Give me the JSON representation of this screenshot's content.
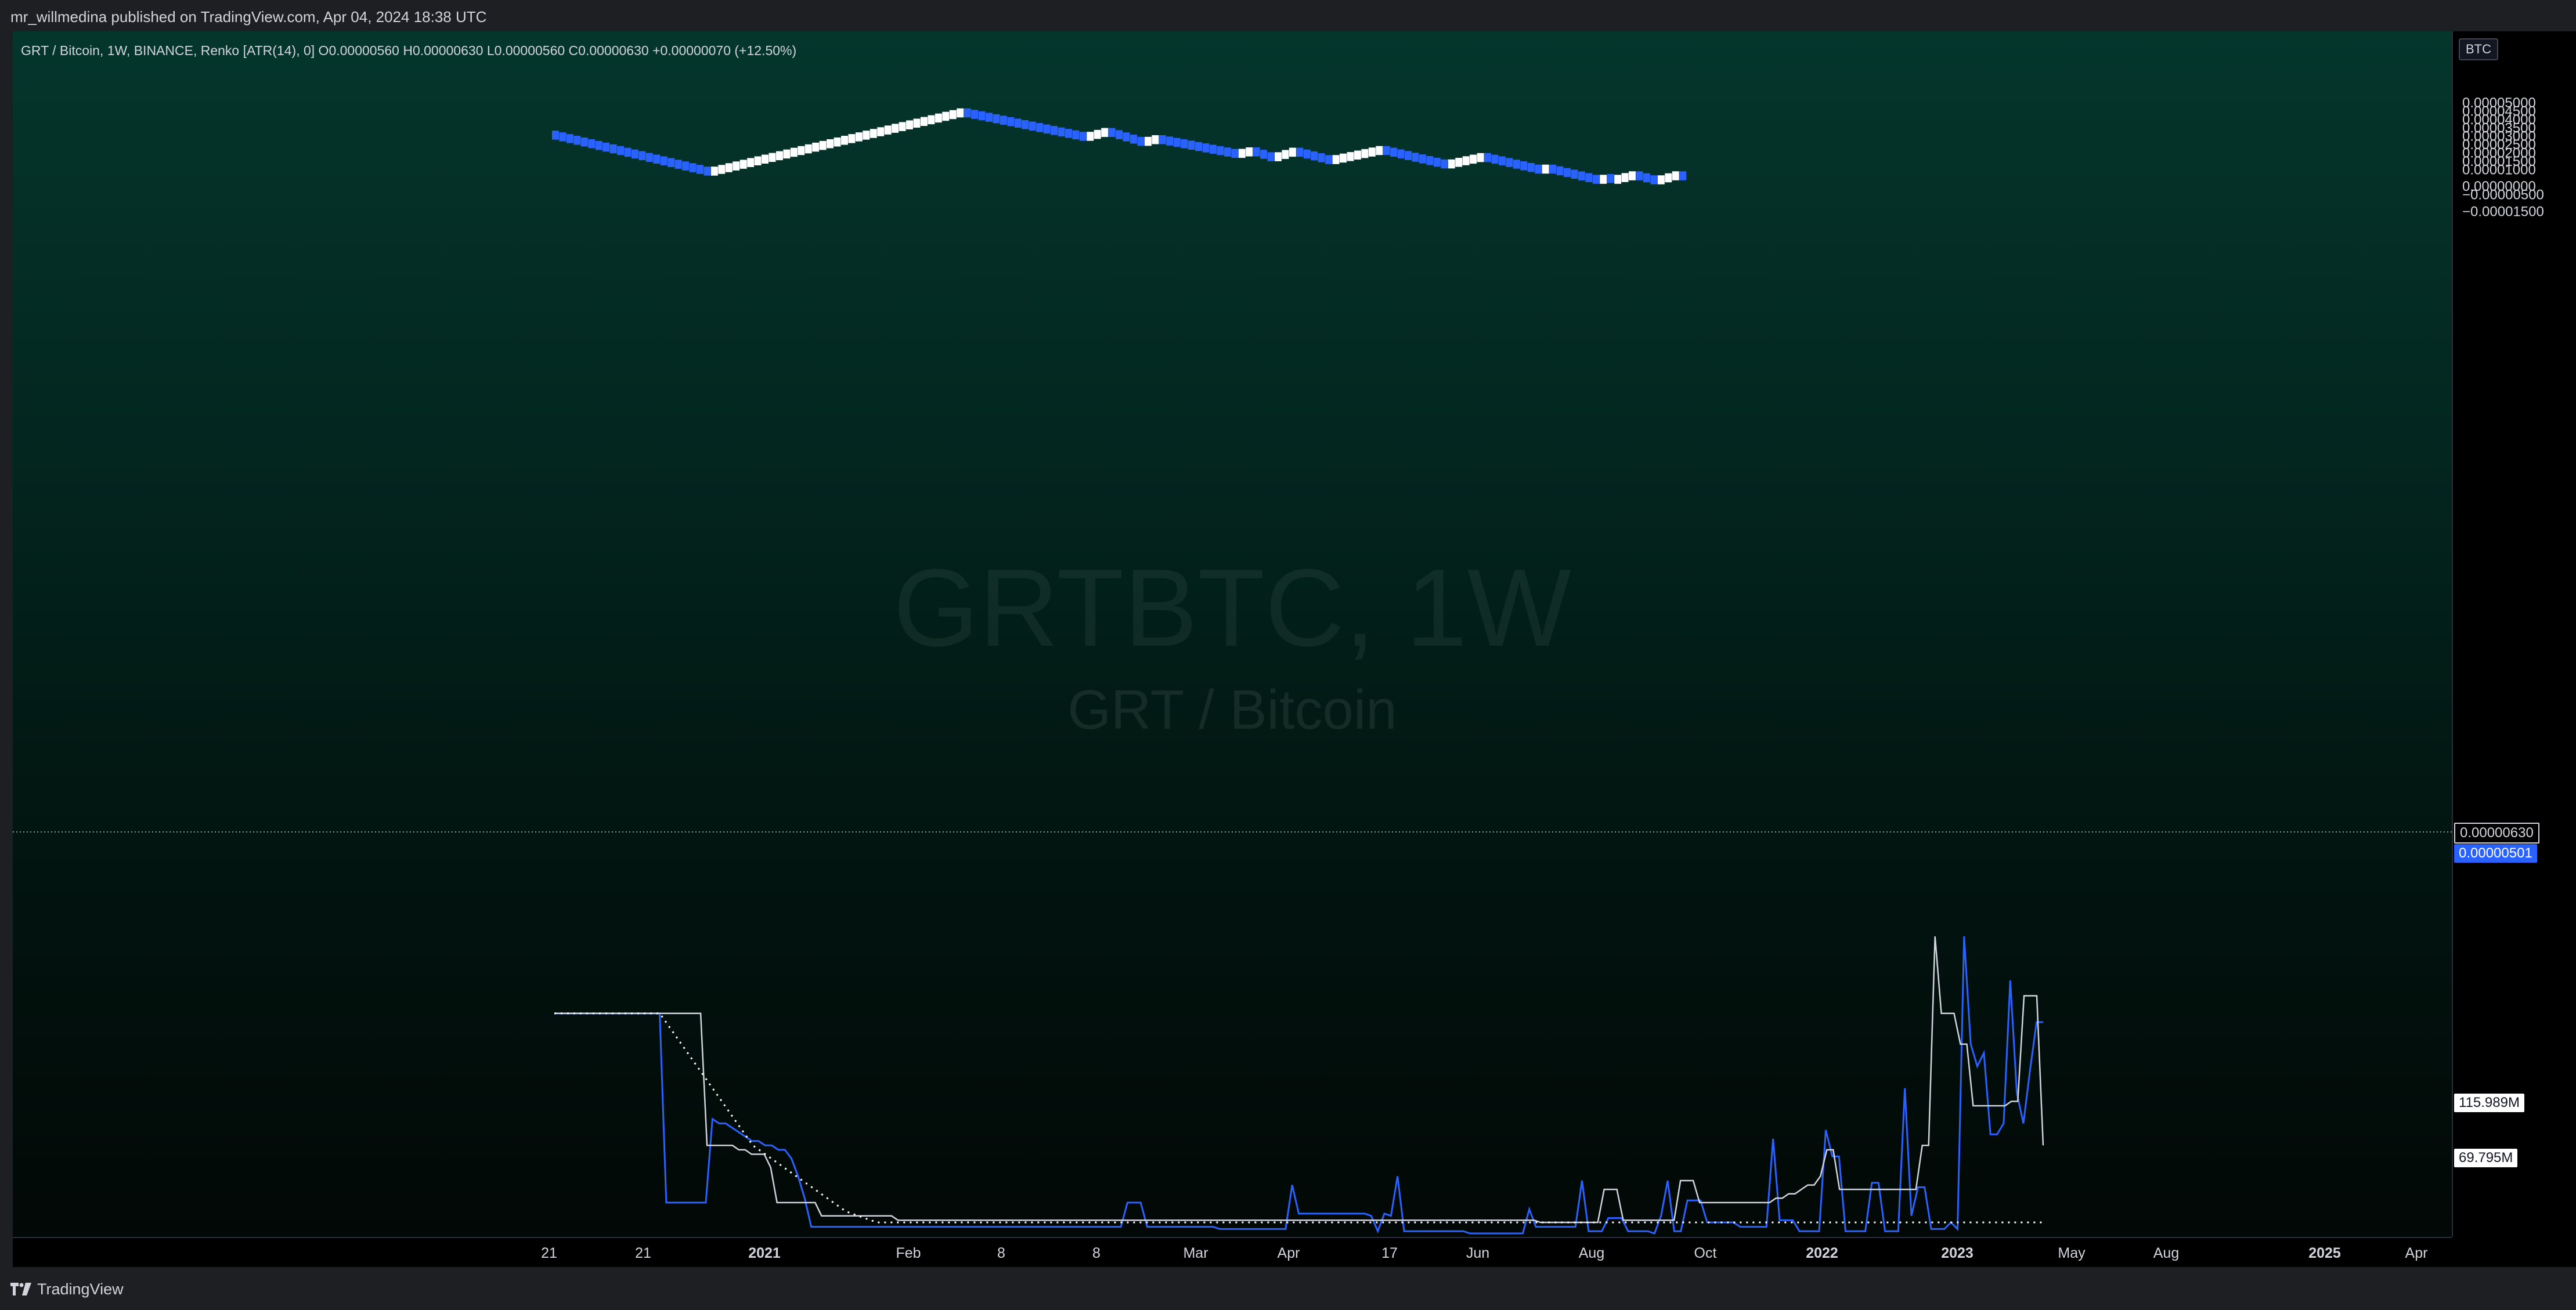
{
  "header": {
    "publisher": "mr_willmedina published on TradingView.com, Apr 04, 2024 18:38 UTC"
  },
  "footer": {
    "logo_text": "TradingView"
  },
  "legend": {
    "text": "GRT / Bitcoin, 1W, BINANCE, Renko [ATR(14), 0]  O0.00000560  H0.00000630  L0.00000560  C0.00000630  +0.00000070 (+12.50%)"
  },
  "watermark": {
    "symbol": "GRTBTC, 1W",
    "name": "GRT / Bitcoin"
  },
  "price_axis": {
    "currency": "BTC",
    "last_price_label": "0.00000630",
    "badge_blue": "0.00000501",
    "badge_vol1": "115.989M",
    "badge_vol2": "69.795M"
  },
  "colors": {
    "up_brick": "#ffffff",
    "down_brick": "#2962ff",
    "badge_blue": "#2962ff",
    "volume_blue": "#2962ff",
    "volume_white": "#d1d4dc"
  },
  "chart_data": {
    "type": "renko",
    "symbol": "GRT / Bitcoin",
    "interval": "1W",
    "exchange": "BINANCE",
    "brick_rule": "Renko [ATR(14), 0]",
    "ohlc": {
      "open": 5.6e-06,
      "high": 6.3e-06,
      "low": 5.6e-06,
      "close": 6.3e-06,
      "change": 7e-07,
      "change_pct": 12.5
    },
    "ylim": [
      -1.5e-06,
      5e-06
    ],
    "y_ticks": [
      "0.00005000",
      "0.00004500",
      "0.00004000",
      "0.00003500",
      "0.00003000",
      "0.00002500",
      "0.00002000",
      "0.00001500",
      "0.00001000",
      "0.00000000",
      "−0.00000500",
      "−0.00001500"
    ],
    "x_ticks": [
      "21",
      "21",
      "2021",
      "Feb",
      "8",
      "8",
      "Mar",
      "Apr",
      "17",
      "Jun",
      "Aug",
      "Oct",
      "2022",
      "2023",
      "May",
      "Aug",
      "2025",
      "Apr"
    ],
    "x_ticks_bold": [
      "2021",
      "2022",
      "2023",
      "2025"
    ],
    "brick_runs": [
      {
        "direction": "down",
        "bricks": 22,
        "from": 3.06e-05,
        "to": 9.1e-06
      },
      {
        "direction": "up",
        "bricks": 35,
        "from": 9.1e-06,
        "to": 4.39e-05
      },
      {
        "direction": "down",
        "bricks": 17,
        "from": 4.39e-05,
        "to": 2.99e-05
      },
      {
        "direction": "up",
        "bricks": 3,
        "from": 2.99e-05,
        "to": 3.22e-05
      },
      {
        "direction": "down",
        "bricks": 5,
        "from": 3.22e-05,
        "to": 2.69e-05
      },
      {
        "direction": "up",
        "bricks": 2,
        "from": 2.69e-05,
        "to": 2.79e-05
      },
      {
        "direction": "down",
        "bricks": 11,
        "from": 2.79e-05,
        "to": 1.97e-05
      },
      {
        "direction": "up",
        "bricks": 2,
        "from": 1.97e-05,
        "to": 2.06e-05
      },
      {
        "direction": "down",
        "bricks": 3,
        "from": 2.06e-05,
        "to": 1.77e-05
      },
      {
        "direction": "up",
        "bricks": 3,
        "from": 1.77e-05,
        "to": 2.04e-05
      },
      {
        "direction": "down",
        "bricks": 5,
        "from": 2.04e-05,
        "to": 1.6e-05
      },
      {
        "direction": "up",
        "bricks": 7,
        "from": 1.6e-05,
        "to": 2.14e-05
      },
      {
        "direction": "down",
        "bricks": 9,
        "from": 2.14e-05,
        "to": 1.34e-05
      },
      {
        "direction": "up",
        "bricks": 5,
        "from": 1.34e-05,
        "to": 1.72e-05
      },
      {
        "direction": "down",
        "bricks": 8,
        "from": 1.72e-05,
        "to": 1.03e-05
      },
      {
        "direction": "up",
        "bricks": 1,
        "from": 1.03e-05,
        "to": 1.03e-05
      },
      {
        "direction": "down",
        "bricks": 7,
        "from": 1.03e-05,
        "to": 4.2e-06
      },
      {
        "direction": "up",
        "bricks": 1,
        "from": 4.2e-06,
        "to": 4.7e-06
      },
      {
        "direction": "down",
        "bricks": 1,
        "from": 4.7e-06,
        "to": 4.2e-06
      },
      {
        "direction": "up",
        "bricks": 3,
        "from": 4.2e-06,
        "to": 6.3e-06
      },
      {
        "direction": "down",
        "bricks": 3,
        "from": 6.3e-06,
        "to": 3.9e-06
      },
      {
        "direction": "up",
        "bricks": 3,
        "from": 3.9e-06,
        "to": 6.3e-06
      },
      {
        "direction": "down",
        "bricks": 1,
        "from": 6.3e-06,
        "to": 5.7e-06
      }
    ],
    "volume_series": [
      {
        "color": "blue",
        "values": [
          100,
          100,
          100,
          100,
          100,
          100,
          100,
          100,
          100,
          100,
          100,
          100,
          100,
          100,
          100,
          100,
          100,
          14,
          14,
          14,
          14,
          14,
          14,
          14,
          52,
          50,
          50,
          48,
          46,
          44,
          42,
          42,
          40,
          40,
          38,
          38,
          34,
          26,
          16,
          3,
          3,
          3,
          3,
          3,
          3,
          3,
          3,
          3,
          3,
          3,
          3,
          3,
          3,
          3,
          3,
          3,
          3,
          3,
          3,
          3,
          3,
          3,
          3,
          3,
          3,
          3,
          3,
          3,
          3,
          3,
          3,
          3,
          3,
          3,
          3,
          3,
          3,
          3,
          3,
          3,
          3,
          3,
          3,
          3,
          3,
          3,
          3,
          14,
          14,
          14,
          3,
          3,
          3,
          3,
          3,
          3,
          3,
          3,
          3,
          3,
          3,
          2,
          2,
          2,
          2,
          2,
          2,
          2,
          2,
          2,
          2,
          2,
          22,
          9,
          9,
          9,
          9,
          9,
          9,
          9,
          9,
          9,
          9,
          9,
          8,
          1,
          9,
          8,
          26,
          1,
          1,
          1,
          1,
          1,
          1,
          1,
          1,
          1,
          1,
          0,
          0,
          0,
          0,
          0,
          0,
          0,
          0,
          0,
          11,
          3,
          3,
          3,
          3,
          3,
          3,
          3,
          24,
          1,
          1,
          1,
          7,
          7,
          7,
          1,
          1,
          1,
          1,
          0,
          8,
          24,
          1,
          1,
          15,
          15,
          15,
          5,
          5,
          5,
          5,
          5,
          3,
          3,
          3,
          3,
          3,
          43,
          6,
          6,
          6,
          1,
          1,
          1,
          1,
          47,
          35,
          35,
          1,
          1,
          1,
          1,
          23,
          23,
          1,
          1,
          1,
          66,
          8,
          21,
          21,
          2,
          2,
          2,
          5,
          2,
          135,
          86,
          76,
          82,
          45,
          45,
          50,
          115,
          64,
          50,
          74,
          96,
          96
        ]
      },
      {
        "color": "white",
        "values": [
          100,
          100,
          100,
          100,
          100,
          100,
          100,
          100,
          100,
          100,
          100,
          100,
          100,
          100,
          100,
          100,
          100,
          100,
          100,
          100,
          100,
          100,
          100,
          100,
          40,
          40,
          40,
          40,
          40,
          38,
          38,
          36,
          36,
          36,
          30,
          14,
          14,
          14,
          14,
          14,
          14,
          14,
          8,
          8,
          8,
          8,
          8,
          8,
          8,
          8,
          8,
          8,
          8,
          8,
          6,
          6,
          6,
          6,
          6,
          6,
          6,
          6,
          6,
          6,
          6,
          6,
          6,
          6,
          6,
          6,
          6,
          6,
          6,
          6,
          6,
          6,
          6,
          6,
          6,
          6,
          6,
          6,
          6,
          6,
          6,
          6,
          6,
          6,
          6,
          6,
          6,
          6,
          6,
          6,
          6,
          6,
          6,
          6,
          6,
          6,
          6,
          6,
          6,
          6,
          6,
          6,
          6,
          6,
          6,
          6,
          6,
          6,
          6,
          6,
          6,
          6,
          6,
          6,
          6,
          6,
          6,
          6,
          6,
          6,
          6,
          6,
          6,
          6,
          6,
          6,
          6,
          6,
          6,
          6,
          6,
          6,
          6,
          6,
          6,
          6,
          6,
          6,
          6,
          6,
          6,
          6,
          6,
          6,
          6,
          6,
          6,
          6,
          6,
          6,
          6,
          5,
          5,
          5,
          5,
          5,
          5,
          5,
          5,
          5,
          5,
          20,
          20,
          20,
          6,
          6,
          6,
          6,
          6,
          6,
          6,
          6,
          6,
          24,
          24,
          24,
          14,
          14,
          14,
          14,
          14,
          14,
          14,
          14,
          14,
          14,
          14,
          14,
          16,
          16,
          18,
          18,
          20,
          22,
          22,
          26,
          38,
          38,
          20,
          20,
          20,
          20,
          20,
          20,
          20,
          20,
          20,
          20,
          20,
          20,
          20,
          40,
          40,
          135,
          100,
          100,
          100,
          86,
          86,
          58,
          58,
          58,
          58,
          58,
          58,
          60,
          60,
          108,
          108,
          108,
          40
        ]
      },
      {
        "color": "dotted",
        "values": [
          100,
          100,
          100,
          100,
          100,
          100,
          100,
          100,
          100,
          100,
          100,
          100,
          100,
          100,
          100,
          100,
          100,
          100,
          96,
          92,
          88,
          84,
          80,
          76,
          72,
          68,
          64,
          60,
          56,
          52,
          48,
          44,
          40,
          38,
          36,
          34,
          32,
          30,
          28,
          26,
          24,
          22,
          20,
          18,
          16,
          14,
          12,
          10,
          9,
          8,
          7,
          6,
          5,
          5,
          5,
          5,
          5,
          5,
          5,
          5,
          5,
          5,
          5,
          5,
          5,
          5,
          5,
          5,
          5,
          5,
          5,
          5,
          5,
          5,
          5,
          5,
          5,
          5,
          5,
          5,
          5,
          5,
          5,
          5,
          5,
          5,
          5,
          5,
          5,
          5,
          5,
          5,
          5,
          5,
          5,
          5,
          5,
          5,
          5,
          5,
          5,
          5,
          5,
          5,
          5,
          5,
          5,
          5,
          5,
          5,
          5,
          5,
          5,
          5,
          5,
          5,
          5,
          5,
          5,
          5,
          5,
          5,
          5,
          5,
          5,
          5,
          5,
          5,
          5,
          5,
          5,
          5,
          5,
          5,
          5,
          5,
          5,
          5,
          5,
          5,
          5,
          5,
          5,
          5,
          5,
          5,
          5,
          5,
          5,
          5,
          5,
          5,
          5,
          5,
          5,
          5,
          5,
          5,
          5,
          5,
          5,
          5,
          5,
          5,
          5,
          5,
          5,
          5,
          5,
          5,
          5,
          5,
          5,
          5,
          5,
          5,
          5,
          5,
          5,
          5,
          5,
          5,
          5,
          5,
          5,
          5,
          5,
          5,
          5,
          5,
          5,
          5,
          5,
          5,
          5,
          5,
          5,
          5,
          5,
          5,
          5,
          5,
          5,
          5,
          5,
          5,
          5,
          5,
          5,
          5,
          5,
          5,
          5,
          5,
          5,
          5,
          5,
          5,
          5,
          5,
          5,
          5,
          5,
          5,
          5,
          5,
          5,
          5,
          5,
          5,
          5,
          5,
          5,
          5,
          5,
          5,
          5,
          5,
          5,
          5,
          5
        ]
      }
    ]
  }
}
